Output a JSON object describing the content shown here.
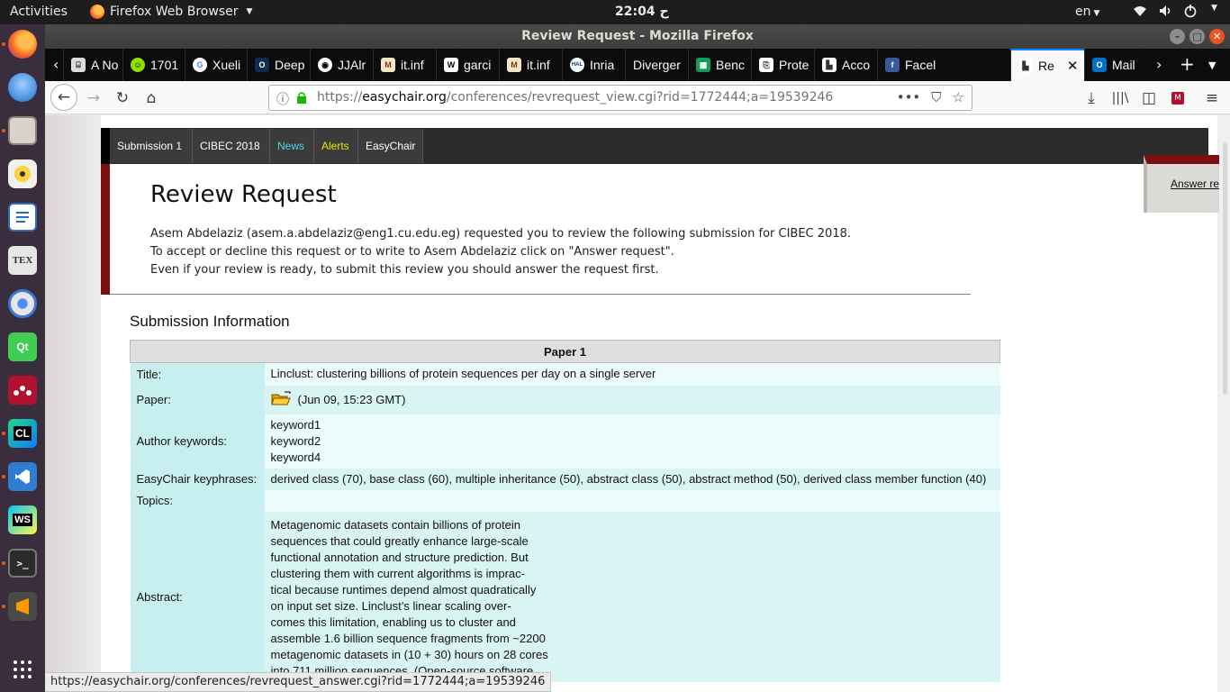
{
  "topbar": {
    "activities": "Activities",
    "app_menu": "Firefox Web Browser",
    "clock": "22:04 ح",
    "lang": "en"
  },
  "dock": {
    "icons": [
      "firefox-icon",
      "thunderbird-icon",
      "files-icon",
      "rhythmbox-icon",
      "writer-icon",
      "texmaker-icon",
      "chromium-icon",
      "qt-creator-icon",
      "mendeley-icon",
      "clion-icon",
      "vscode-icon",
      "webstorm-icon",
      "terminal-icon",
      "sublime-icon",
      "show-apps-icon"
    ],
    "texmaker_label": "TEX",
    "clion_label": "CL",
    "qt_label": "Qt",
    "webstorm_label": "WS"
  },
  "window": {
    "title": "Review Request - Mozilla Firefox"
  },
  "tabs": [
    {
      "label": "A No",
      "icon": "tab-icon-generic"
    },
    {
      "label": "1701",
      "icon": "tab-icon-smiley"
    },
    {
      "label": "Xueli",
      "icon": "google-icon"
    },
    {
      "label": "Deep",
      "icon": "openreview-icon"
    },
    {
      "label": "JJAlr",
      "icon": "github-icon"
    },
    {
      "label": "it.inf",
      "icon": "mo-icon"
    },
    {
      "label": "garci",
      "icon": "wiki-icon"
    },
    {
      "label": "it.inf",
      "icon": "mo-icon"
    },
    {
      "label": "Inria",
      "icon": "hal-icon"
    },
    {
      "label": "Diverger",
      "icon": "blank-icon"
    },
    {
      "label": "Benc",
      "icon": "sheets-icon"
    },
    {
      "label": "Prote",
      "icon": "protocol-icon"
    },
    {
      "label": "Acco",
      "icon": "account-icon"
    },
    {
      "label": "Facel",
      "icon": "facebook-icon"
    },
    {
      "label": "Re",
      "icon": "easychair-icon",
      "active": true
    },
    {
      "label": "Mail",
      "icon": "outlook-icon"
    }
  ],
  "urlbar": {
    "prefix": "https://",
    "host": "easychair.org",
    "path": "/conferences/revrequest_view.cgi?rid=1772444;a=19539246"
  },
  "page": {
    "menu": [
      "Submission 1",
      "CIBEC 2018",
      "News",
      "Alerts",
      "EasyChair"
    ],
    "title": "Review Request",
    "intro": [
      "Asem Abdelaziz (asem.a.abdelaziz@eng1.cu.edu.eg) requested you to review the following submission for CIBEC 2018.",
      "To accept or decline this request or to write to Asem Abdelaziz click on \"Answer request\".",
      "Even if your review is ready, to submit this review you should answer the request first."
    ],
    "answer_link": "Answer request",
    "section_heading": "Submission Information",
    "table": {
      "header": "Paper 1",
      "title_label": "Title:",
      "title_value": "Linclust: clustering billions of protein sequences per day on a single server",
      "paper_label": "Paper:",
      "paper_value": "(Jun 09, 15:23 GMT)",
      "keywords_label": "Author keywords:",
      "keywords": [
        "keyword1",
        "keyword2",
        "keyword4"
      ],
      "keyphrases_label": "EasyChair keyphrases:",
      "keyphrases_value": "derived class (70), base class (60), multiple inheritance (50), abstract class (50), abstract method (50), derived class member function (40)",
      "topics_label": "Topics:",
      "topics_value": "",
      "abstract_label": "Abstract:",
      "abstract_lines": [
        "Metagenomic datasets contain billions of protein",
        "sequences that could greatly enhance large-scale",
        "functional annotation and structure prediction. But",
        "clustering them with current algorithms is imprac-",
        "tical because runtimes depend almost quadratically",
        "on input set size. Linclust’s linear scaling over-",
        "comes this limitation, enabling us to cluster and",
        "assemble 1.6 billion sequence fragments from ~2200",
        "metagenomic datasets in (10 + 30) hours on 28 cores",
        "into 711 million sequences. (Open-source software"
      ]
    }
  },
  "statusbar": {
    "url": "https://easychair.org/conferences/revrequest_answer.cgi?rid=1772444;a=19539246"
  },
  "colors": {
    "menubar": "#2c2c2c",
    "accent_red": "#7a0f0f",
    "news": "#4fd7e6",
    "alerts": "#f2e400",
    "label_cell": "#c8efef"
  }
}
